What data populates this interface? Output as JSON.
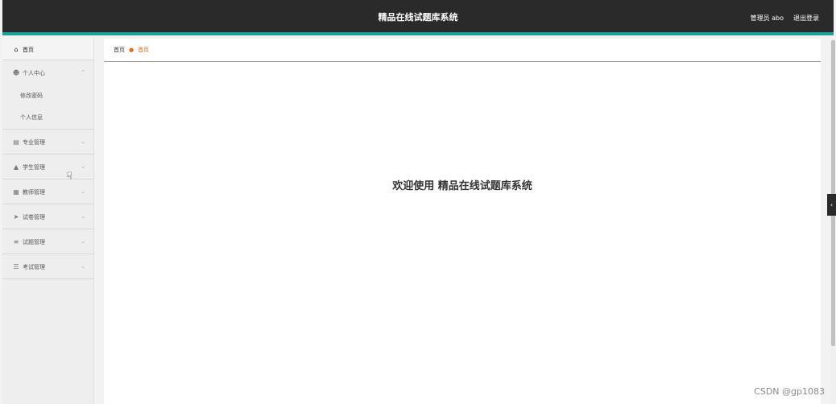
{
  "header": {
    "title": "精品在线试题库系统",
    "user_label": "管理员 abo",
    "logout_label": "退出登录"
  },
  "sidebar": {
    "home": "首页",
    "personal": {
      "label": "个人中心",
      "items": [
        "修改密码",
        "个人信息"
      ]
    },
    "groups": [
      {
        "label": "专业管理",
        "icon": "id-card-icon"
      },
      {
        "label": "学生管理",
        "icon": "student-icon"
      },
      {
        "label": "教师管理",
        "icon": "teacher-icon"
      },
      {
        "label": "试卷管理",
        "icon": "paper-plane-icon"
      },
      {
        "label": "试题管理",
        "icon": "list-icon"
      },
      {
        "label": "考试管理",
        "icon": "sliders-icon"
      }
    ]
  },
  "breadcrumb": {
    "first": "首页",
    "current": "首页"
  },
  "main": {
    "welcome": "欢迎使用 精品在线试题库系统"
  },
  "watermark": "CSDN @gp1083",
  "colors": {
    "header_bg": "#2a2a2a",
    "accent_teal": "#1aa094",
    "breadcrumb_accent": "#e26b17"
  }
}
